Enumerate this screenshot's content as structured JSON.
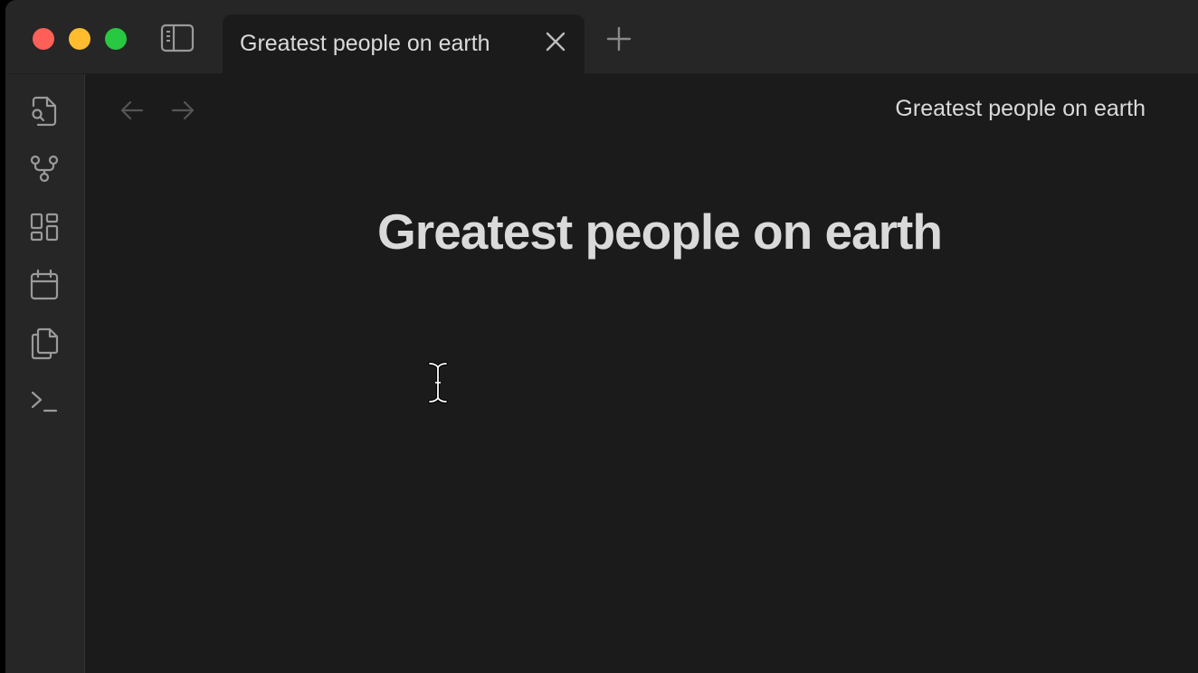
{
  "window": {
    "traffic_lights": [
      "close",
      "minimize",
      "zoom"
    ],
    "colors": {
      "close": "#fe5f57",
      "minimize": "#febc2e",
      "zoom": "#28c840"
    }
  },
  "tabs": [
    {
      "label": "Greatest people on earth",
      "active": true
    }
  ],
  "ribbon": {
    "icons": [
      "search-file-icon",
      "graph-icon",
      "blocks-icon",
      "calendar-icon",
      "copy-icon",
      "terminal-icon"
    ]
  },
  "header": {
    "title": "Greatest people on earth"
  },
  "note": {
    "title": "Greatest people on earth"
  }
}
